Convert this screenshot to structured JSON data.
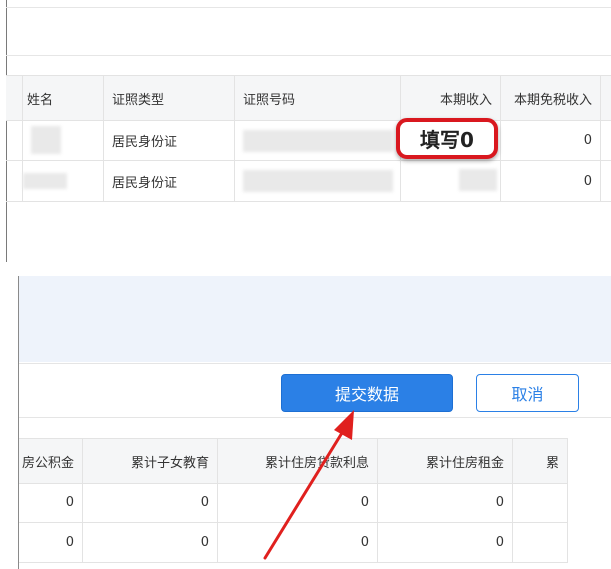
{
  "top_table": {
    "headers": [
      "姓名",
      "证照类型",
      "证照号码",
      "本期收入",
      "本期免税收入"
    ],
    "rows": [
      {
        "id_type": "居民身份证",
        "tax_free_income": "0"
      },
      {
        "id_type": "居民身份证",
        "tax_free_income": "0"
      }
    ]
  },
  "callout": {
    "text": "填写0"
  },
  "toolbar": {
    "submit_label": "提交数据",
    "cancel_label": "取消"
  },
  "bottom_table": {
    "headers": [
      "房公积金",
      "累计子女教育",
      "累计住房贷款利息",
      "累计住房租金",
      "累"
    ],
    "rows": [
      [
        "0",
        "0",
        "0",
        "0"
      ],
      [
        "0",
        "0",
        "0",
        "0"
      ]
    ]
  },
  "colors": {
    "accent": "#2b80e6",
    "callout_border": "#d9181f",
    "arrow": "#e0201e"
  }
}
